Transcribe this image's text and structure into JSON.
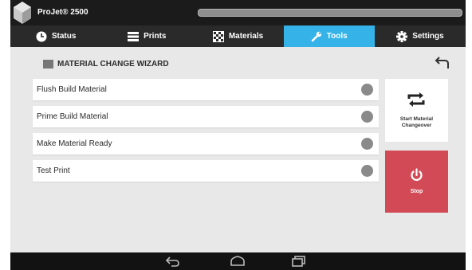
{
  "app": {
    "title": "ProJet® 2500"
  },
  "tabs": [
    {
      "label": "Status",
      "icon": "clock-icon"
    },
    {
      "label": "Prints",
      "icon": "list-icon"
    },
    {
      "label": "Materials",
      "icon": "checker-icon"
    },
    {
      "label": "Tools",
      "icon": "wrench-icon",
      "active": true
    },
    {
      "label": "Settings",
      "icon": "gear-icon"
    }
  ],
  "wizard": {
    "title": "MATERIAL CHANGE WIZARD",
    "steps": [
      {
        "label": "Flush Build Material"
      },
      {
        "label": "Prime Build Material"
      },
      {
        "label": "Make Material Ready"
      },
      {
        "label": "Test Print"
      }
    ],
    "start_button_line1": "Start Material",
    "start_button_line2": "Changeover",
    "stop_button": "Stop"
  },
  "colors": {
    "accent": "#35b3e8",
    "stop": "#d24a56",
    "titlebar": "#1b1b1b",
    "tabbar": "#2a2a2a"
  }
}
